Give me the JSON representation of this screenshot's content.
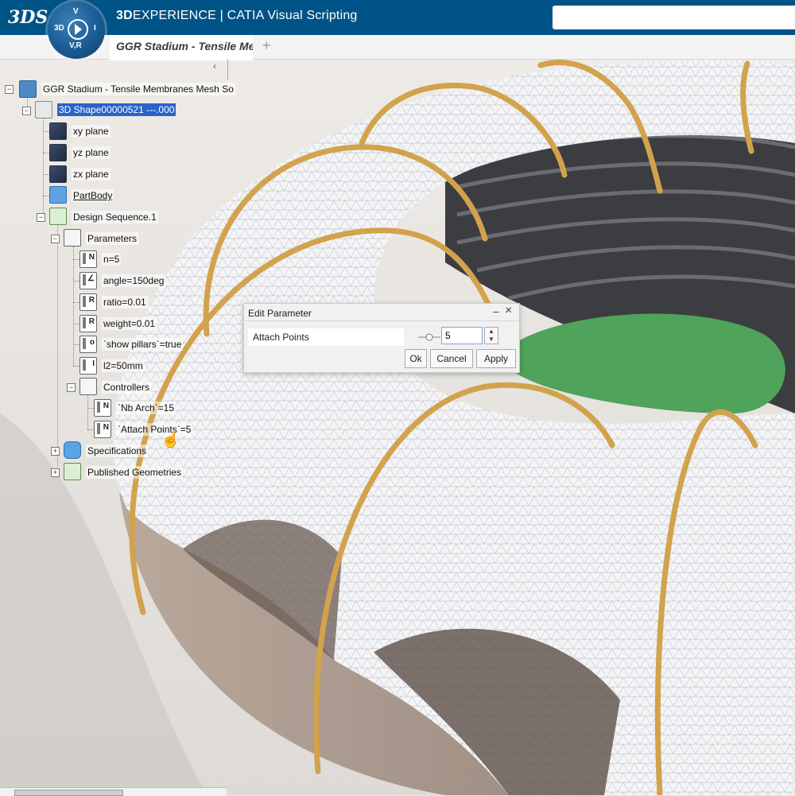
{
  "app": {
    "brand_logo": "3DS",
    "title_bold": "3D",
    "title_rest": "EXPERIENCE | CATIA Visual Scripting",
    "compass_top": "V",
    "compass_left": "3D",
    "compass_right": "I",
    "compass_bottom": "V,R"
  },
  "tabs": [
    {
      "label": "GGR Stadium - Tensile Me",
      "active": true
    }
  ],
  "tab_add": "+",
  "tree": {
    "collapse_symbol": "‹",
    "root": "GGR Stadium - Tensile Membranes Mesh So",
    "shape": "3D Shape00000521 ---.000",
    "xy": "xy plane",
    "yz": "yz plane",
    "zx": "zx plane",
    "partbody": "PartBody",
    "design_sequence": "Design Sequence.1",
    "parameters": "Parameters",
    "p_n": "n=5",
    "p_angle": "angle=150deg",
    "p_ratio": "ratio=0.01",
    "p_weight": "weight=0.01",
    "p_pillars": "`show pillars`=true",
    "p_l2": "l2=50mm",
    "controllers": "Controllers",
    "c_arch": "`Nb Arch`=15",
    "c_attach": "`Attach Points`=5",
    "specifications": "Specifications",
    "published": "Published Geometries"
  },
  "dialog": {
    "title": "Edit Parameter",
    "min": "–",
    "close": "×",
    "param_label": "Attach Points",
    "value": "5",
    "spin_up": "▲",
    "spin_down": "▼",
    "ok": "Ok",
    "cancel": "Cancel",
    "apply": "Apply"
  },
  "colors": {
    "topbar": "#005386",
    "selection": "#2a63c8",
    "membrane": "#f4f4f6",
    "arch": "#d2a24c",
    "field": "#4fa35a"
  }
}
